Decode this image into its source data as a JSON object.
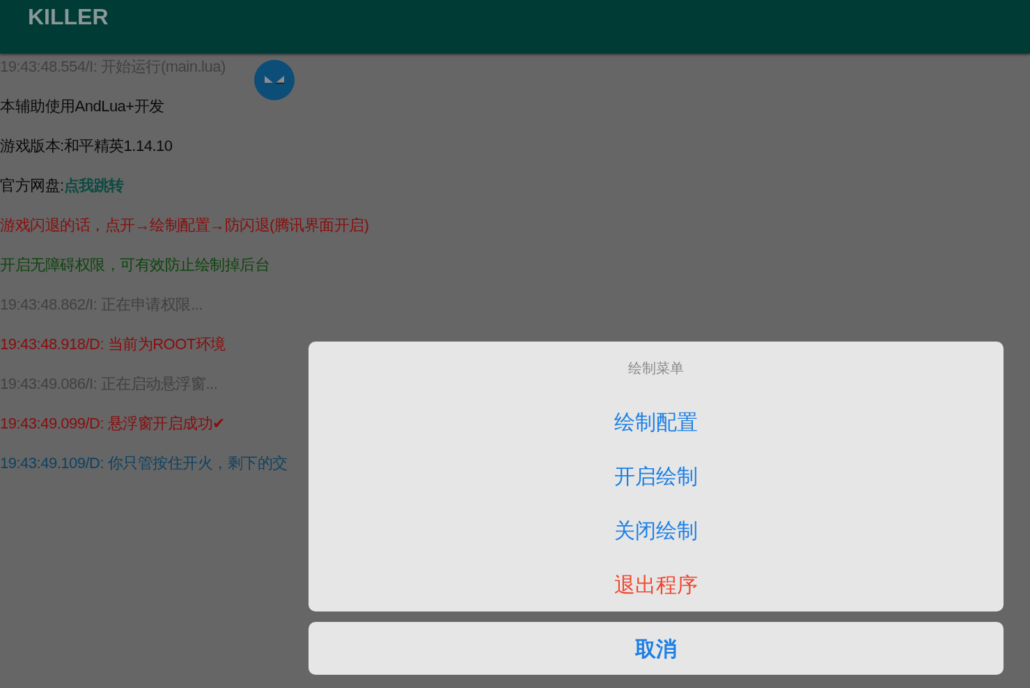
{
  "app_bar": {
    "title": "KILLER"
  },
  "log": [
    {
      "text": "19:43:48.554/I: 开始运行(main.lua)",
      "color": "#414141"
    },
    {
      "text": "本辅助使用AndLua+开发",
      "color": "#0a0a0a"
    },
    {
      "text": "游戏版本:和平精英1.14.10",
      "color": "#0a0a0a"
    },
    {
      "text": "官方网盘:",
      "color": "#0a0a0a",
      "link": {
        "text": "点我跳转",
        "color": "#0b4a42"
      }
    },
    {
      "text": "游戏闪退的话，点开→绘制配置→防闪退(腾讯界面开启)",
      "color": "#8a0c0c"
    },
    {
      "text": "开启无障碍权限，可有效防止绘制掉后台",
      "color": "#0e460e"
    },
    {
      "text": "19:43:48.862/I: 正在申请权限...",
      "color": "#414141"
    },
    {
      "text": "19:43:48.918/D: 当前为ROOT环境",
      "color": "#8a0c0c"
    },
    {
      "text": "19:43:49.086/I: 正在启动悬浮窗...",
      "color": "#414141"
    },
    {
      "text": "19:43:49.099/D: 悬浮窗开启成功✔",
      "color": "#8a0c0c"
    },
    {
      "text": "19:43:49.109/D: 你只管按住开火，剩下的交",
      "color": "#0e4260"
    }
  ],
  "action_sheet": {
    "title": "绘制菜单",
    "items": [
      {
        "label": "绘制配置",
        "kind": "default"
      },
      {
        "label": "开启绘制",
        "kind": "default"
      },
      {
        "label": "关闭绘制",
        "kind": "default"
      },
      {
        "label": "退出程序",
        "kind": "destructive"
      }
    ],
    "cancel": "取消"
  }
}
